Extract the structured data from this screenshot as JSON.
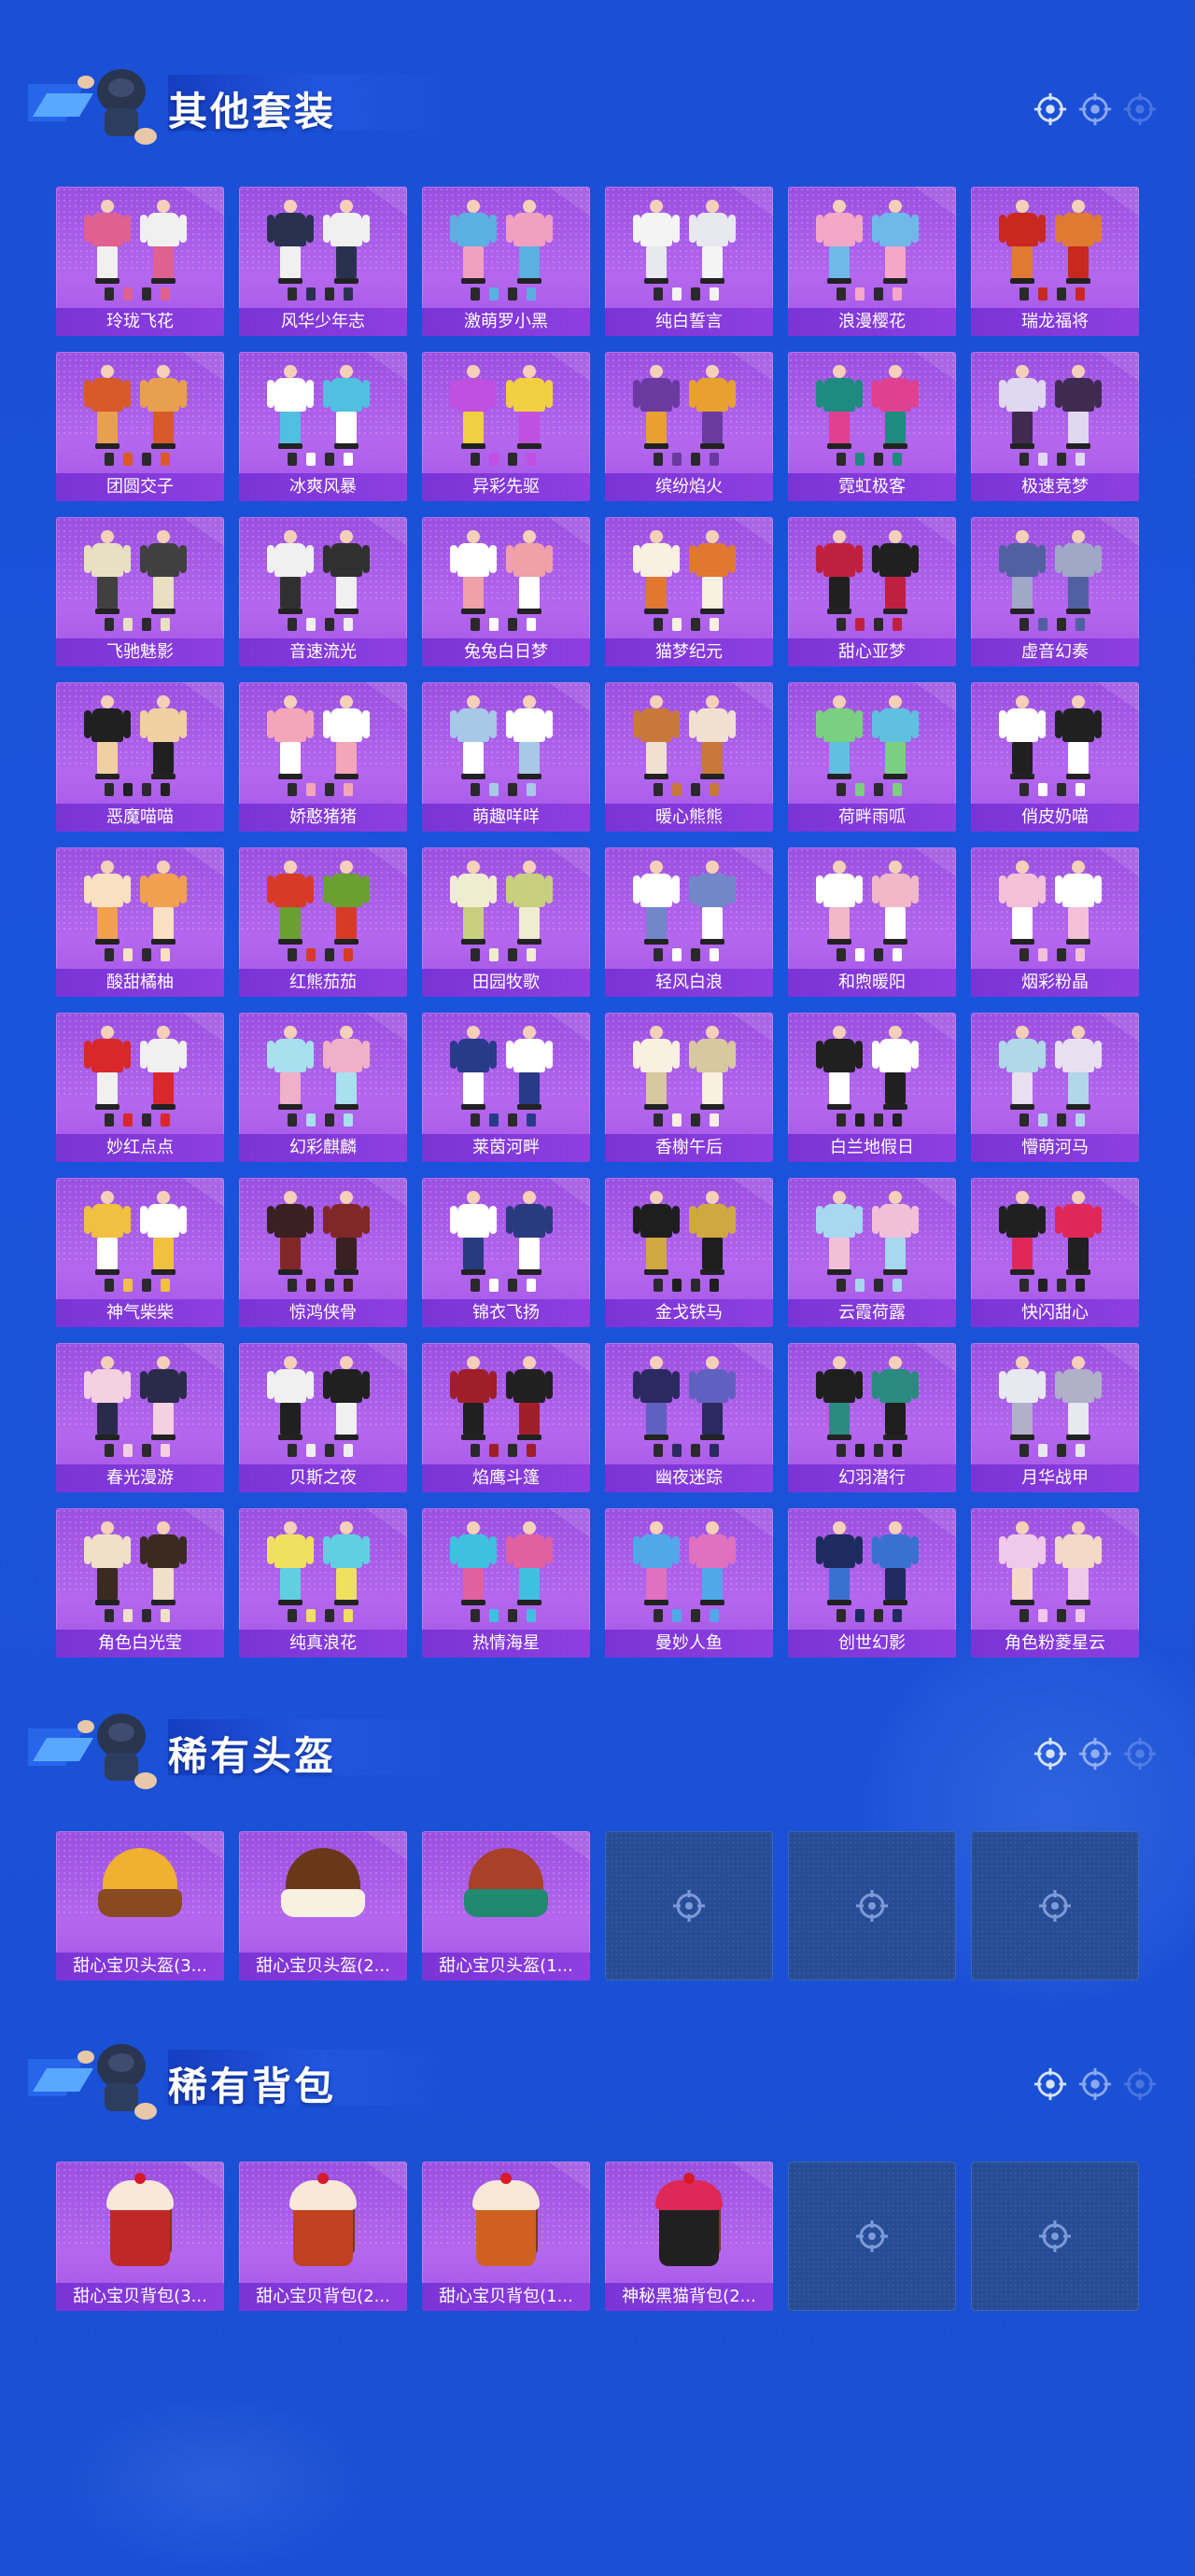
{
  "sections": [
    {
      "title": "其他套装",
      "items": [
        {
          "label": "玲珑飞花",
          "c1": "#e06090",
          "c2": "#f0f0f0"
        },
        {
          "label": "风华少年志",
          "c1": "#2a3150",
          "c2": "#f0f0f0"
        },
        {
          "label": "激萌罗小黑",
          "c1": "#5ab0e0",
          "c2": "#f2a0c0"
        },
        {
          "label": "纯白誓言",
          "c1": "#f4f4f4",
          "c2": "#e8e8f0"
        },
        {
          "label": "浪漫樱花",
          "c1": "#f3a8c8",
          "c2": "#70b8e8"
        },
        {
          "label": "瑞龙福将",
          "c1": "#c8281e",
          "c2": "#e07a30"
        },
        {
          "label": "团圆交子",
          "c1": "#d85a28",
          "c2": "#e8a050"
        },
        {
          "label": "冰爽风暴",
          "c1": "#ffffff",
          "c2": "#50c0e0"
        },
        {
          "label": "异彩先驱",
          "c1": "#c050e0",
          "c2": "#f0d040"
        },
        {
          "label": "缤纷焰火",
          "c1": "#6a3aa0",
          "c2": "#e8a030"
        },
        {
          "label": "霓虹极客",
          "c1": "#1e8a80",
          "c2": "#e04090"
        },
        {
          "label": "极速竞梦",
          "c1": "#e0d8f0",
          "c2": "#402a50"
        },
        {
          "label": "飞驰魅影",
          "c1": "#e8e0c0",
          "c2": "#404040"
        },
        {
          "label": "音速流光",
          "c1": "#f0f0f0",
          "c2": "#303030"
        },
        {
          "label": "兔兔白日梦",
          "c1": "#ffffff",
          "c2": "#f0a0a8"
        },
        {
          "label": "猫梦纪元",
          "c1": "#f8f0e0",
          "c2": "#e07830"
        },
        {
          "label": "甜心亚梦",
          "c1": "#c02040",
          "c2": "#202020"
        },
        {
          "label": "虚音幻奏",
          "c1": "#5060a0",
          "c2": "#a0a8c8"
        },
        {
          "label": "恶魔喵喵",
          "c1": "#202020",
          "c2": "#f0d0a0"
        },
        {
          "label": "娇憨猪猪",
          "c1": "#f4a6b8",
          "c2": "#ffffff"
        },
        {
          "label": "萌趣咩咩",
          "c1": "#a8c8e8",
          "c2": "#ffffff"
        },
        {
          "label": "暖心熊熊",
          "c1": "#c8783a",
          "c2": "#f0e0d0"
        },
        {
          "label": "荷畔雨呱",
          "c1": "#7ad080",
          "c2": "#60c0e0"
        },
        {
          "label": "俏皮奶喵",
          "c1": "#ffffff",
          "c2": "#202020"
        },
        {
          "label": "酸甜橘柚",
          "c1": "#f8e0c0",
          "c2": "#f0a050"
        },
        {
          "label": "红熊茄茄",
          "c1": "#d83a28",
          "c2": "#6aa030"
        },
        {
          "label": "田园牧歌",
          "c1": "#f0ecd0",
          "c2": "#c8d080"
        },
        {
          "label": "轻风白浪",
          "c1": "#ffffff",
          "c2": "#7088c8"
        },
        {
          "label": "和煦暖阳",
          "c1": "#ffffff",
          "c2": "#f0b8c8"
        },
        {
          "label": "烟彩粉晶",
          "c1": "#f4c0d8",
          "c2": "#ffffff"
        },
        {
          "label": "妙红点点",
          "c1": "#d8282a",
          "c2": "#f0f0f0"
        },
        {
          "label": "幻彩麒麟",
          "c1": "#a8e0f0",
          "c2": "#f0b0c8"
        },
        {
          "label": "莱茵河畔",
          "c1": "#283a8a",
          "c2": "#ffffff"
        },
        {
          "label": "香榭午后",
          "c1": "#f8f0e0",
          "c2": "#d8c8a0"
        },
        {
          "label": "白兰地假日",
          "c1": "#202020",
          "c2": "#ffffff"
        },
        {
          "label": "懵萌河马",
          "c1": "#b0d8e8",
          "c2": "#e8e0f0"
        },
        {
          "label": "神气柴柴",
          "c1": "#f0c040",
          "c2": "#ffffff"
        },
        {
          "label": "惊鸿侠骨",
          "c1": "#3a2020",
          "c2": "#802828"
        },
        {
          "label": "锦衣飞扬",
          "c1": "#ffffff",
          "c2": "#2a3a80"
        },
        {
          "label": "金戈铁马",
          "c1": "#1e1e1e",
          "c2": "#d0a840"
        },
        {
          "label": "云霞荷露",
          "c1": "#a8d8f0",
          "c2": "#f0c0d8"
        },
        {
          "label": "快闪甜心",
          "c1": "#202020",
          "c2": "#e02858"
        },
        {
          "label": "春光漫游",
          "c1": "#f4d0e0",
          "c2": "#2a2a4a"
        },
        {
          "label": "贝斯之夜",
          "c1": "#f0f0f0",
          "c2": "#202020"
        },
        {
          "label": "焰鹰斗篷",
          "c1": "#a01e28",
          "c2": "#202020"
        },
        {
          "label": "幽夜迷踪",
          "c1": "#2a2a60",
          "c2": "#6060c0"
        },
        {
          "label": "幻羽潜行",
          "c1": "#1e1e1e",
          "c2": "#2a8a80"
        },
        {
          "label": "月华战甲",
          "c1": "#e8e8f0",
          "c2": "#b0b0c8"
        },
        {
          "label": "角色白光莹",
          "c1": "#f0e0c8",
          "c2": "#3a2a20"
        },
        {
          "label": "纯真浪花",
          "c1": "#f0e060",
          "c2": "#60d0e0"
        },
        {
          "label": "热情海星",
          "c1": "#40c0e0",
          "c2": "#e060a0"
        },
        {
          "label": "曼妙人鱼",
          "c1": "#50a8e8",
          "c2": "#e070c0"
        },
        {
          "label": "创世幻影",
          "c1": "#1e2a60",
          "c2": "#3a70d0"
        },
        {
          "label": "角色粉菱星云",
          "c1": "#f0c8e8",
          "c2": "#f4d8c8"
        }
      ]
    },
    {
      "title": "稀有头盔",
      "items": [
        {
          "label": "甜心宝贝头盔(3...",
          "c1": "#f0b030",
          "c2": "#8a4a20"
        },
        {
          "label": "甜心宝贝头盔(2...",
          "c1": "#6a3818",
          "c2": "#f8f0e0"
        },
        {
          "label": "甜心宝贝头盔(1...",
          "c1": "#a8402a",
          "c2": "#208a70"
        }
      ],
      "empty_slots": 3
    },
    {
      "title": "稀有背包",
      "items": [
        {
          "label": "甜心宝贝背包(3...",
          "c1": "#c02828",
          "c2": "#f8e8d8"
        },
        {
          "label": "甜心宝贝背包(2...",
          "c1": "#c04020",
          "c2": "#f8e8d8"
        },
        {
          "label": "甜心宝贝背包(1...",
          "c1": "#d06020",
          "c2": "#f8e8d8"
        },
        {
          "label": "神秘黑猫背包(2...",
          "c1": "#202020",
          "c2": "#e02858"
        }
      ],
      "empty_slots": 2
    }
  ],
  "header_icons": [
    "crosshair-icon",
    "crosshair-icon",
    "crosshair-icon"
  ],
  "colors": {
    "background": "#1a4fd6",
    "card": "#b467ee",
    "label_bar": "#8e3fe0",
    "empty_slot": "#274c96"
  }
}
